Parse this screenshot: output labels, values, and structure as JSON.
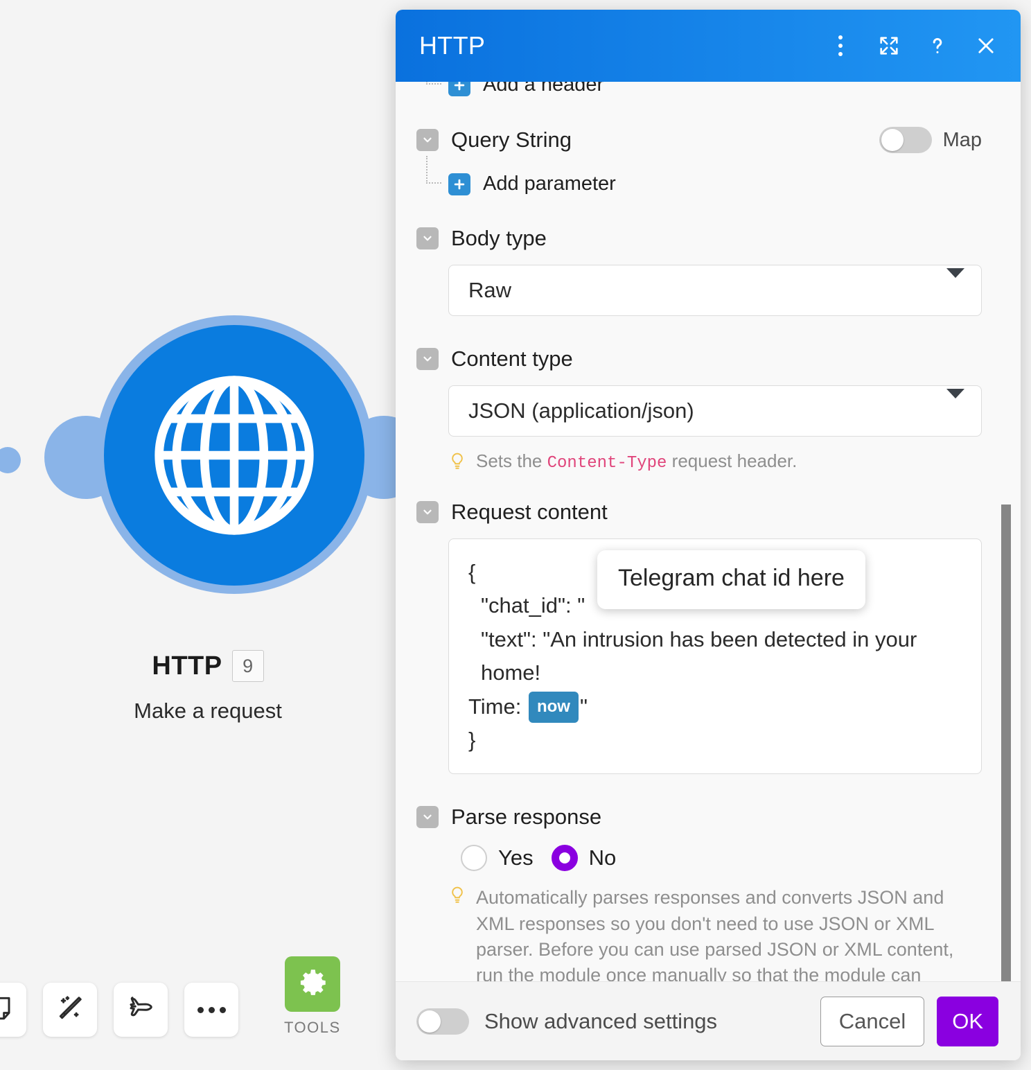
{
  "canvas": {
    "module": {
      "title": "HTTP",
      "badge": "9",
      "subtitle": "Make a request",
      "icon": "globe-icon"
    },
    "toolbar": {
      "items": [
        {
          "name": "note-icon",
          "label": "Note"
        },
        {
          "name": "magic-wand-icon",
          "label": "Magic wand"
        },
        {
          "name": "paper-plane-icon",
          "label": "Paper plane"
        },
        {
          "name": "more-icon",
          "label": "More"
        }
      ],
      "tools": {
        "label": "TOOLS",
        "icon": "gear-icon",
        "color": "#7dc24f"
      }
    }
  },
  "dialog": {
    "title": "HTTP",
    "header_icons": [
      {
        "name": "kebab-menu-icon",
        "glyph": "⋮"
      },
      {
        "name": "expand-icon",
        "glyph": "⤢"
      },
      {
        "name": "help-icon",
        "glyph": "?"
      },
      {
        "name": "close-icon",
        "glyph": "✕"
      }
    ],
    "sections": {
      "add_header_label": "Add a header",
      "query_string": {
        "label": "Query String",
        "map_label": "Map",
        "map_enabled": false,
        "add_parameter_label": "Add parameter"
      },
      "body_type": {
        "label": "Body type",
        "value": "Raw"
      },
      "content_type": {
        "label": "Content type",
        "value": "JSON (application/json)",
        "hint_prefix": "Sets the ",
        "hint_code": "Content-Type",
        "hint_suffix": " request header."
      },
      "request_content": {
        "label": "Request content",
        "line_open": "{",
        "line_chat_id": "\"chat_id\": \"",
        "line_text": "\"text\": \"An intrusion has been detected in your home!",
        "line_time_prefix": "Time:",
        "line_time_pill": "now",
        "line_time_suffix": "\"",
        "line_close": "}",
        "tooltip": "Telegram chat id here"
      },
      "parse_response": {
        "label": "Parse response",
        "options": [
          {
            "label": "Yes",
            "selected": false
          },
          {
            "label": "No",
            "selected": true
          }
        ],
        "hint": "Automatically parses responses and converts JSON and XML responses so you don't need to use JSON or XML parser. Before you can use parsed JSON or XML content, run the module once manually so that the module can recognize the response content and allows you to map it in subsequent modules."
      }
    },
    "footer": {
      "advanced_label": "Show advanced settings",
      "advanced_enabled": false,
      "cancel_label": "Cancel",
      "ok_label": "OK"
    }
  },
  "colors": {
    "header_gradient_start": "#0a71de",
    "header_gradient_end": "#2196f3",
    "accent_purple": "#8a00e0",
    "module_blue": "#0a7cdf",
    "module_halo": "#8ab4e8",
    "pill_blue": "#3189bd",
    "code_pink": "#e0457b",
    "tools_green": "#7dc24f"
  }
}
